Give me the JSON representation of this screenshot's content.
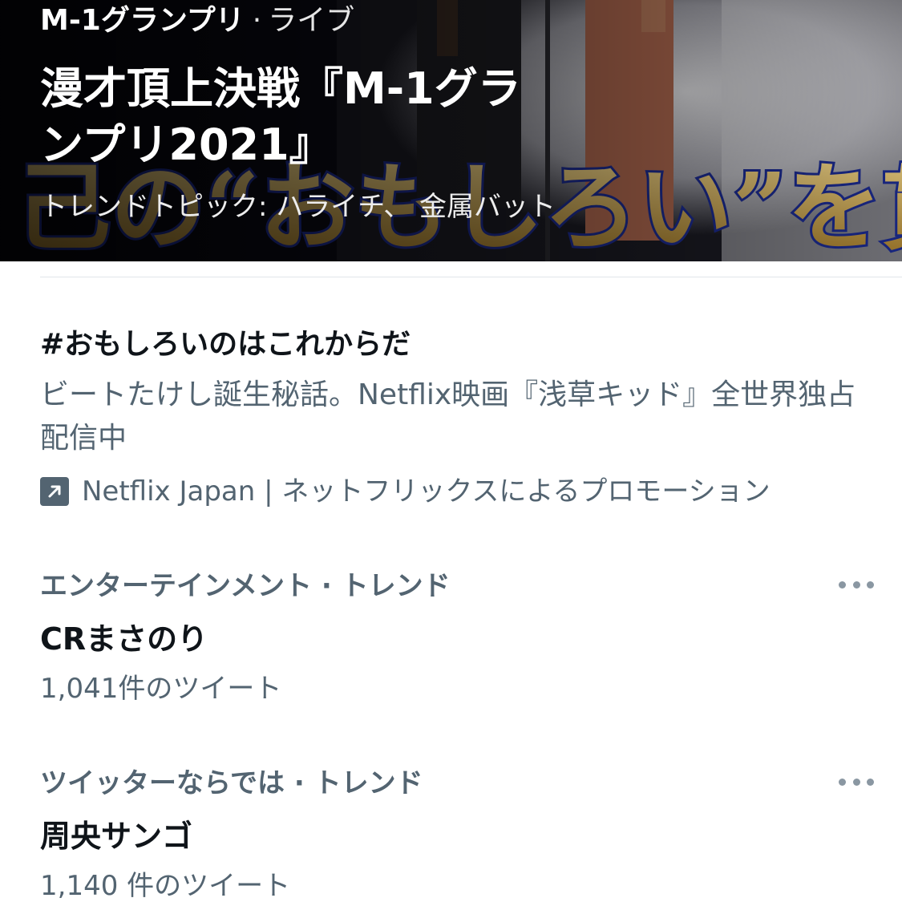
{
  "live_event": {
    "event_name": "M-1グランプリ",
    "separator": "·",
    "status": "ライブ",
    "title": "漫才頂上決戦『M-1グランプリ2021』",
    "trending_topics": "トレンドトピック: ハライチ、 金属バット",
    "banner_caption": "己の“おもしろい”を貫いた"
  },
  "promoted_trend": {
    "hashtag": "#おもしろいのはこれからだ",
    "description": "ビートたけし誕生秘話。Netflix映画『浅草キッド』全世界独占配信中",
    "promoted_by": "Netflix Japan | ネットフリックスによるプロモーション",
    "icon": "promoted-arrow-icon"
  },
  "trends": [
    {
      "context": "エンターテインメント · トレンド",
      "name": "CRまさのり",
      "tweet_count": "1,041件のツイート",
      "more_icon": "more-dots-icon"
    },
    {
      "context": "ツイッターならでは · トレンド",
      "name": "周央サンゴ",
      "tweet_count": "1,140 件のツイート",
      "more_icon": "more-dots-icon"
    }
  ],
  "colors": {
    "primary_text": "#0f1419",
    "secondary_text": "#536471",
    "banner_gold": "#c9a24a",
    "divider": "#e1e6ea"
  }
}
